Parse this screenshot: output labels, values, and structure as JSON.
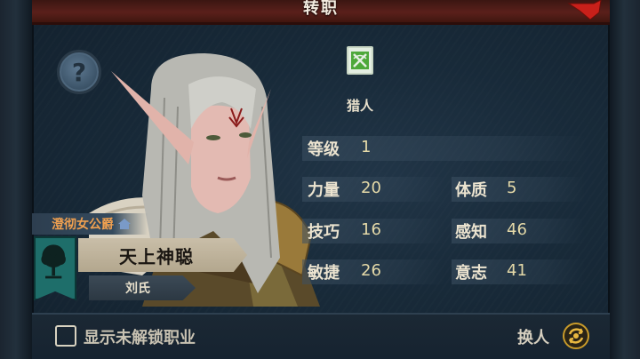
{
  "header": {
    "title": "转职"
  },
  "help": {
    "glyph": "?"
  },
  "character": {
    "noble_title": "澄彻女公爵",
    "name": "天上神聪",
    "family": "刘氏"
  },
  "class": {
    "name": "猎人",
    "icon": "crossed-bow-icon"
  },
  "stats": {
    "level": {
      "label": "等级",
      "value": "1"
    },
    "strength": {
      "label": "力量",
      "value": "20"
    },
    "constitution": {
      "label": "体质",
      "value": "5"
    },
    "skill": {
      "label": "技巧",
      "value": "16"
    },
    "perception": {
      "label": "感知",
      "value": "46"
    },
    "agility": {
      "label": "敏捷",
      "value": "26"
    },
    "will": {
      "label": "意志",
      "value": "41"
    }
  },
  "footer": {
    "show_locked_label": "显示未解锁职业",
    "show_locked_checked": false,
    "swap_label": "换人"
  },
  "colors": {
    "title_bar": "#5a201b",
    "panel": "#182a39",
    "noble_title": "#f0a050",
    "stat_value": "#e4d9a8",
    "banner": "#1e6e6a"
  }
}
